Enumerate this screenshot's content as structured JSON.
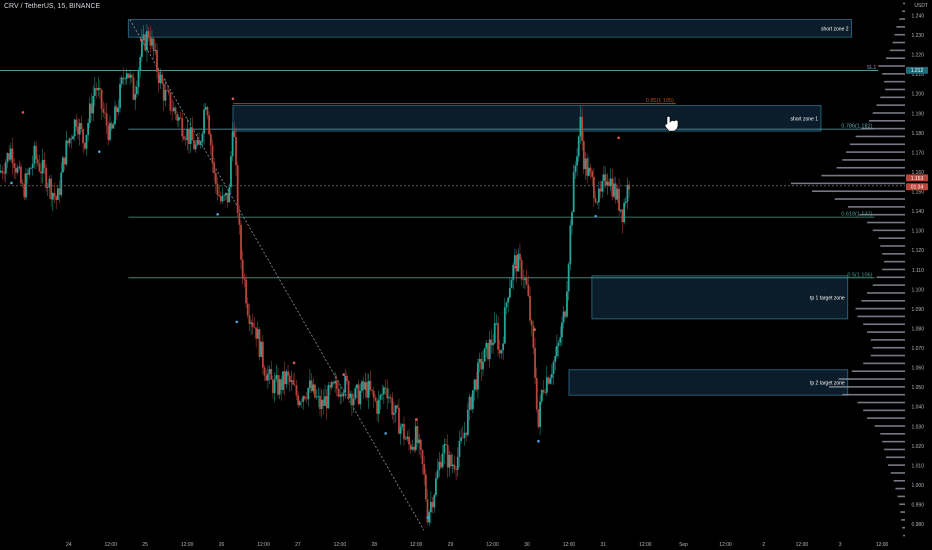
{
  "header": {
    "title": "CRV / TetherUS, 15, BINANCE"
  },
  "chart_data": {
    "type": "candlestick",
    "title": "CRV / TetherUS, 15, BINANCE",
    "y_unit": "USDT",
    "ylim": [
      0.973,
      1.248
    ],
    "y_ticks": [
      "1.240",
      "1.230",
      "1.220",
      "1.210",
      "1.200",
      "1.190",
      "1.180",
      "1.170",
      "1.160",
      "1.150",
      "1.140",
      "1.130",
      "1.120",
      "1.110",
      "1.100",
      "1.090",
      "1.080",
      "1.070",
      "1.060",
      "1.050",
      "1.040",
      "1.030",
      "1.020",
      "1.010",
      "1.000",
      "0.990",
      "0.980"
    ],
    "x_ticks": [
      {
        "label": "24",
        "x": 0.9
      },
      {
        "label": "12:00",
        "x": 1.45
      },
      {
        "label": "25",
        "x": 1.9
      },
      {
        "label": "12:00",
        "x": 2.45
      },
      {
        "label": "26",
        "x": 2.9
      },
      {
        "label": "12:00",
        "x": 3.45
      },
      {
        "label": "27",
        "x": 3.9
      },
      {
        "label": "12:00",
        "x": 4.45
      },
      {
        "label": "28",
        "x": 4.9
      },
      {
        "label": "12:00",
        "x": 5.45
      },
      {
        "label": "29",
        "x": 5.9
      },
      {
        "label": "12:00",
        "x": 6.45
      },
      {
        "label": "30",
        "x": 6.9
      },
      {
        "label": "12:00",
        "x": 7.45
      },
      {
        "label": "31",
        "x": 7.9
      },
      {
        "label": "12:00",
        "x": 8.45
      },
      {
        "label": "Sep",
        "x": 8.95
      },
      {
        "label": "12:00",
        "x": 9.5
      },
      {
        "label": "2",
        "x": 10.0
      },
      {
        "label": "12:00",
        "x": 10.5
      },
      {
        "label": "3",
        "x": 11.0
      },
      {
        "label": "12:00",
        "x": 11.55
      }
    ],
    "xlim": [
      0.0,
      11.85
    ],
    "price_path": [
      [
        0.0,
        1.16
      ],
      [
        0.15,
        1.172
      ],
      [
        0.3,
        1.15
      ],
      [
        0.45,
        1.168
      ],
      [
        0.6,
        1.158
      ],
      [
        0.75,
        1.145
      ],
      [
        0.85,
        1.17
      ],
      [
        1.0,
        1.188
      ],
      [
        1.1,
        1.175
      ],
      [
        1.25,
        1.205
      ],
      [
        1.35,
        1.19
      ],
      [
        1.45,
        1.178
      ],
      [
        1.55,
        1.196
      ],
      [
        1.65,
        1.215
      ],
      [
        1.75,
        1.2
      ],
      [
        1.85,
        1.222
      ],
      [
        1.95,
        1.232
      ],
      [
        2.05,
        1.214
      ],
      [
        2.15,
        1.2
      ],
      [
        2.3,
        1.19
      ],
      [
        2.45,
        1.18
      ],
      [
        2.6,
        1.17
      ],
      [
        2.7,
        1.2
      ],
      [
        2.8,
        1.158
      ],
      [
        2.9,
        1.144
      ],
      [
        3.0,
        1.148
      ],
      [
        3.05,
        1.19
      ],
      [
        3.1,
        1.15
      ],
      [
        3.15,
        1.118
      ],
      [
        3.25,
        1.09
      ],
      [
        3.35,
        1.08
      ],
      [
        3.45,
        1.062
      ],
      [
        3.55,
        1.052
      ],
      [
        3.65,
        1.05
      ],
      [
        3.75,
        1.055
      ],
      [
        3.9,
        1.045
      ],
      [
        4.05,
        1.05
      ],
      [
        4.2,
        1.04
      ],
      [
        4.35,
        1.048
      ],
      [
        4.5,
        1.052
      ],
      [
        4.65,
        1.045
      ],
      [
        4.8,
        1.05
      ],
      [
        4.95,
        1.04
      ],
      [
        5.05,
        1.052
      ],
      [
        5.15,
        1.038
      ],
      [
        5.25,
        1.03
      ],
      [
        5.35,
        1.02
      ],
      [
        5.45,
        1.025
      ],
      [
        5.55,
        1.005
      ],
      [
        5.6,
        0.985
      ],
      [
        5.7,
        1.0
      ],
      [
        5.8,
        1.02
      ],
      [
        5.9,
        1.01
      ],
      [
        6.0,
        1.015
      ],
      [
        6.1,
        1.03
      ],
      [
        6.2,
        1.05
      ],
      [
        6.3,
        1.062
      ],
      [
        6.4,
        1.07
      ],
      [
        6.5,
        1.08
      ],
      [
        6.55,
        1.065
      ],
      [
        6.65,
        1.1
      ],
      [
        6.75,
        1.115
      ],
      [
        6.85,
        1.108
      ],
      [
        6.9,
        1.1
      ],
      [
        6.95,
        1.082
      ],
      [
        7.0,
        1.06
      ],
      [
        7.05,
        1.03
      ],
      [
        7.1,
        1.05
      ],
      [
        7.2,
        1.058
      ],
      [
        7.3,
        1.068
      ],
      [
        7.4,
        1.09
      ],
      [
        7.45,
        1.12
      ],
      [
        7.5,
        1.15
      ],
      [
        7.55,
        1.17
      ],
      [
        7.6,
        1.185
      ],
      [
        7.65,
        1.165
      ],
      [
        7.75,
        1.155
      ],
      [
        7.85,
        1.145
      ],
      [
        7.95,
        1.16
      ],
      [
        8.05,
        1.15
      ],
      [
        8.15,
        1.14
      ],
      [
        8.25,
        1.158
      ]
    ],
    "pivot_highs": [
      [
        0.3,
        1.189
      ],
      [
        1.85,
        1.226
      ],
      [
        3.05,
        1.196
      ],
      [
        3.85,
        1.061
      ],
      [
        4.5,
        1.055
      ],
      [
        5.45,
        1.032
      ],
      [
        6.75,
        1.11
      ],
      [
        7.0,
        1.078
      ],
      [
        8.1,
        1.176
      ]
    ],
    "pivot_lows": [
      [
        0.15,
        1.156
      ],
      [
        1.3,
        1.172
      ],
      [
        2.85,
        1.14
      ],
      [
        3.1,
        1.085
      ],
      [
        5.05,
        1.028
      ],
      [
        5.6,
        0.985
      ],
      [
        7.05,
        1.024
      ],
      [
        7.8,
        1.139
      ]
    ],
    "trendline": {
      "from": [
        1.7,
        1.238
      ],
      "to": [
        5.55,
        0.977
      ]
    },
    "zones": [
      {
        "label": "short zone 2",
        "x0": 1.68,
        "x1": 11.15,
        "y_top": 1.238,
        "y_bot": 1.229
      },
      {
        "label": "short zone 1",
        "x0": 3.05,
        "x1": 10.75,
        "y_top": 1.194,
        "y_bot": 1.181
      },
      {
        "label": "tp 1 target zone",
        "x0": 7.75,
        "x1": 11.1,
        "y_top": 1.107,
        "y_bot": 1.085
      },
      {
        "label": "tp 2 target zone",
        "x0": 7.45,
        "x1": 11.1,
        "y_top": 1.059,
        "y_bot": 1.046
      }
    ],
    "levels": [
      {
        "label": "SL1",
        "y": 1.212,
        "color": "#5fa8b8",
        "x0": 0.0,
        "x1": 11.5
      },
      {
        "label": "0.786(1.182)",
        "y": 1.182,
        "color": "#5fa8b8",
        "x0": 1.68,
        "x1": 11.45
      },
      {
        "label": "0.618(1.137)",
        "y": 1.137,
        "color": "#4a9c8c",
        "x0": 1.68,
        "x1": 11.45
      },
      {
        "label": "0.5(1.106)",
        "y": 1.106,
        "color": "#4a9c8c",
        "x0": 1.68,
        "x1": 11.45
      },
      {
        "label": "0.85(1.195)",
        "y": 1.195,
        "color": "#a05a2c",
        "x0": 3.05,
        "x1": 8.85
      }
    ],
    "price_labels": [
      {
        "label": "1.212",
        "y": 1.212,
        "bg": "#1e6a78"
      },
      {
        "label": "1.153",
        "y": 1.157,
        "bg": "#b8463a"
      },
      {
        "label": "01:34",
        "y": 1.1525,
        "bg": "#b8463a"
      }
    ],
    "current_price": 1.153,
    "volume_profile": [
      [
        1.246,
        2
      ],
      [
        1.242,
        3
      ],
      [
        1.238,
        6
      ],
      [
        1.234,
        9
      ],
      [
        1.23,
        11
      ],
      [
        1.226,
        13
      ],
      [
        1.222,
        16
      ],
      [
        1.218,
        20
      ],
      [
        1.214,
        28
      ],
      [
        1.21,
        24
      ],
      [
        1.206,
        22
      ],
      [
        1.202,
        21
      ],
      [
        1.198,
        26
      ],
      [
        1.194,
        30
      ],
      [
        1.19,
        34
      ],
      [
        1.186,
        38
      ],
      [
        1.182,
        46
      ],
      [
        1.178,
        52
      ],
      [
        1.174,
        58
      ],
      [
        1.17,
        62
      ],
      [
        1.166,
        66
      ],
      [
        1.162,
        72
      ],
      [
        1.158,
        88
      ],
      [
        1.154,
        120
      ],
      [
        1.15,
        98
      ],
      [
        1.146,
        74
      ],
      [
        1.142,
        60
      ],
      [
        1.138,
        48
      ],
      [
        1.134,
        40
      ],
      [
        1.13,
        34
      ],
      [
        1.126,
        28
      ],
      [
        1.122,
        26
      ],
      [
        1.118,
        24
      ],
      [
        1.114,
        22
      ],
      [
        1.11,
        24
      ],
      [
        1.106,
        30
      ],
      [
        1.102,
        34
      ],
      [
        1.098,
        40
      ],
      [
        1.094,
        46
      ],
      [
        1.09,
        52
      ],
      [
        1.086,
        50
      ],
      [
        1.082,
        44
      ],
      [
        1.078,
        40
      ],
      [
        1.074,
        36
      ],
      [
        1.07,
        34
      ],
      [
        1.066,
        36
      ],
      [
        1.062,
        44
      ],
      [
        1.058,
        56
      ],
      [
        1.054,
        70
      ],
      [
        1.05,
        80
      ],
      [
        1.046,
        66
      ],
      [
        1.042,
        50
      ],
      [
        1.038,
        44
      ],
      [
        1.034,
        40
      ],
      [
        1.03,
        32
      ],
      [
        1.026,
        26
      ],
      [
        1.022,
        24
      ],
      [
        1.018,
        22
      ],
      [
        1.014,
        20
      ],
      [
        1.01,
        18
      ],
      [
        1.006,
        15
      ],
      [
        1.002,
        12
      ],
      [
        0.998,
        10
      ],
      [
        0.994,
        8
      ],
      [
        0.99,
        6
      ],
      [
        0.986,
        5
      ],
      [
        0.982,
        4
      ],
      [
        0.978,
        3
      ],
      [
        0.974,
        2
      ]
    ],
    "colors": {
      "up": "#26a69a",
      "down": "#b8463a",
      "zone_fill": "#0b1c2a",
      "zone_border": "#2f6f8a",
      "grid": "#000000",
      "volume": "#8a8f99",
      "trendline": "#9598a1"
    }
  }
}
